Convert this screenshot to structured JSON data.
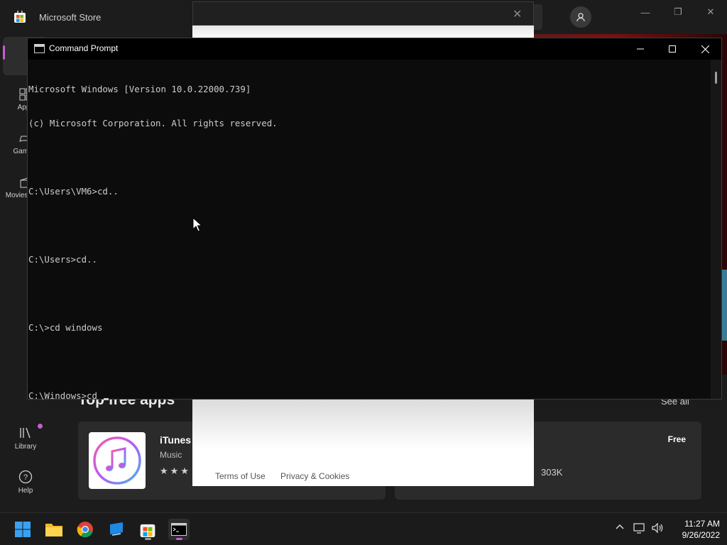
{
  "store": {
    "title": "Microsoft Store",
    "nav": {
      "apps_label": "Apps",
      "gaming_label": "Gaming",
      "movies_label": "Movies & TV",
      "library_label": "Library",
      "help_label": "Help"
    },
    "section_title": "Top free apps",
    "see_all": "See all",
    "app": {
      "name": "iTunes",
      "category": "Music",
      "stars": "★★★",
      "price": "Free",
      "rating_count": "303K"
    }
  },
  "modal": {
    "terms_link": "Terms of Use",
    "privacy_link": "Privacy & Cookies"
  },
  "cmd": {
    "title": "Command Prompt",
    "lines": [
      "Microsoft Windows [Version 10.0.22000.739]",
      "(c) Microsoft Corporation. All rights reserved.",
      "",
      "C:\\Users\\VM6>cd..",
      "",
      "C:\\Users>cd..",
      "",
      "C:\\>cd windows",
      "",
      "C:\\Windows>cd "
    ]
  },
  "taskbar": {
    "time": "11:27 AM",
    "date": "9/26/2022"
  },
  "colors": {
    "accent": "#c55fd0",
    "cmd_bg": "#0c0c0c",
    "cmd_text": "#cccccc"
  }
}
